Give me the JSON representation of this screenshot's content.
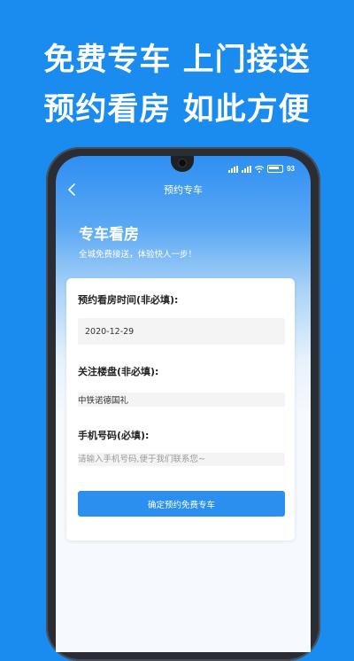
{
  "promo": {
    "line1": "免费专车 上门接送",
    "line2": "预约看房 如此方便"
  },
  "status_bar": {
    "battery": "93"
  },
  "navbar": {
    "title": "预约专车"
  },
  "hero": {
    "title": "专车看房",
    "subtitle": "全城免费接送，体验快人一步！"
  },
  "form": {
    "time_label": "预约看房时间(非必填):",
    "time_value": "2020-12-29",
    "building_label": "关注楼盘(非必填):",
    "building_value": "中铁诺德国礼",
    "phone_label": "手机号码(必填):",
    "phone_value": "",
    "phone_placeholder": "请输入手机号码,便于我们联系您~",
    "submit_label": "确定预约免费专车"
  },
  "colors": {
    "background": "#1a8cf0",
    "primary_button": "#2b8ff0"
  },
  "icons": [
    "back-arrow-icon",
    "signal-icon",
    "wifi-icon",
    "battery-icon"
  ]
}
